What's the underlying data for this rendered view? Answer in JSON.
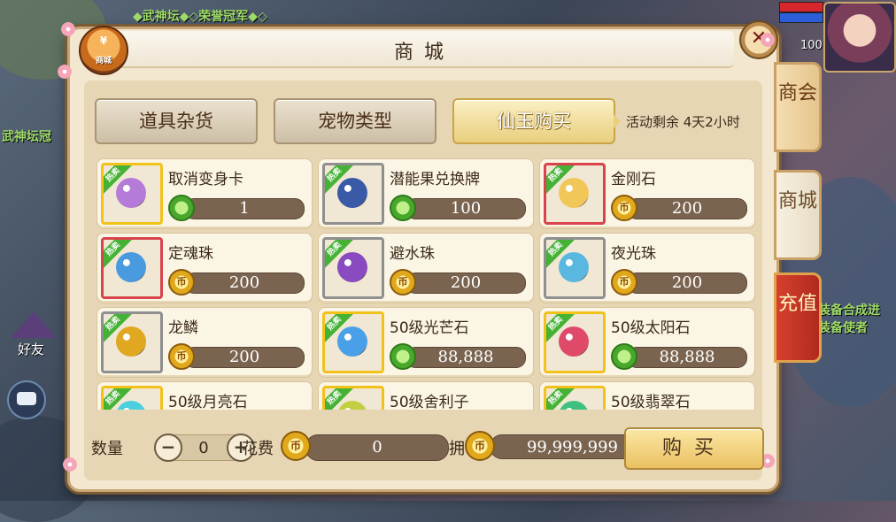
{
  "background": {
    "hud_text_top": "◆武神坛◆◇荣誉冠军◆◇",
    "hud_text_left": "武神坛冠",
    "hud_text_right1": "装备合成进",
    "hud_text_right2": "装备使者",
    "level": "100",
    "friends_label": "好友"
  },
  "panel": {
    "title": "商城",
    "badge_label": "商城",
    "badge_symbol": "¥",
    "close_symbol": "✕"
  },
  "tabs": [
    {
      "label": "道具杂货",
      "active": false
    },
    {
      "label": "宠物类型",
      "active": false
    },
    {
      "label": "仙玉购买",
      "active": true
    }
  ],
  "remaining": "活动剩余 4天2小时",
  "items": [
    {
      "name": "取消变身卡",
      "price": "1",
      "currency": "green",
      "frame": "gold",
      "hot": "热卖",
      "art": "#b57bd8"
    },
    {
      "name": "潜能果兑换牌",
      "price": "100",
      "currency": "green",
      "frame": "gray",
      "hot": "热卖",
      "art": "#3a5aa8"
    },
    {
      "name": "金刚石",
      "price": "200",
      "currency": "gold",
      "frame": "red",
      "hot": "热卖",
      "art": "#f2c75a"
    },
    {
      "name": "定魂珠",
      "price": "200",
      "currency": "gold",
      "frame": "red",
      "hot": "热卖",
      "art": "#4a9ae0"
    },
    {
      "name": "避水珠",
      "price": "200",
      "currency": "gold",
      "frame": "gray",
      "hot": "热卖",
      "art": "#8a4ac0"
    },
    {
      "name": "夜光珠",
      "price": "200",
      "currency": "gold",
      "frame": "gray",
      "hot": "热卖",
      "art": "#5ab8e0"
    },
    {
      "name": "龙鳞",
      "price": "200",
      "currency": "gold",
      "frame": "gray",
      "hot": "热卖",
      "art": "#e0a820"
    },
    {
      "name": "50级光芒石",
      "price": "88,888",
      "currency": "green",
      "frame": "gold",
      "hot": "热卖",
      "art": "#4aa0e8"
    },
    {
      "name": "50级太阳石",
      "price": "88,888",
      "currency": "green",
      "frame": "gold",
      "hot": "热卖",
      "art": "#e04a6a"
    },
    {
      "name": "50级月亮石",
      "price": "",
      "currency": "green",
      "frame": "gold",
      "hot": "热卖",
      "art": "#4ad0e0"
    },
    {
      "name": "50级舍利子",
      "price": "",
      "currency": "green",
      "frame": "gold",
      "hot": "热卖",
      "art": "#c0d040"
    },
    {
      "name": "50级翡翠石",
      "price": "",
      "currency": "green",
      "frame": "gold",
      "hot": "热卖",
      "art": "#40c080"
    }
  ],
  "bottom": {
    "qty_label": "数量",
    "qty_minus": "−",
    "qty_value": "0",
    "qty_plus": "+",
    "cost_label": "花费",
    "cost_value": "0",
    "own_label": "拥有",
    "own_value": "99,999,999",
    "buy_label": "购买"
  },
  "side_tabs": [
    {
      "label": "商会"
    },
    {
      "label": "商城"
    },
    {
      "label": "充值"
    }
  ]
}
